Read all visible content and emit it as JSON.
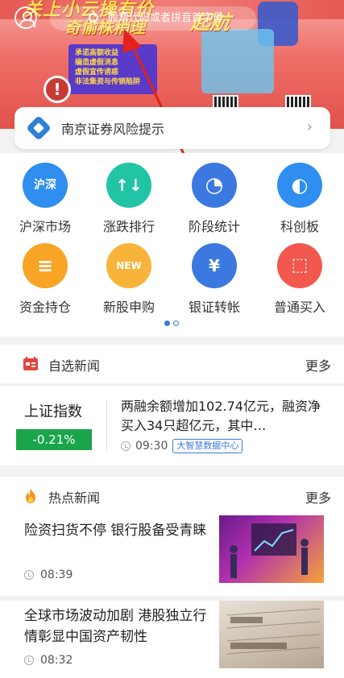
{
  "banner": {
    "headline": "关上小云操有价",
    "headline2": "奇偷株稍理",
    "cta": "起航",
    "board_items": [
      "承诺高额收益",
      "编造虚假消息",
      "虚假宣传诱惑",
      "非法集资与传销陷阱"
    ],
    "warning_glyph": "!",
    "search_placeholder": "股票代码或者拼音首字母"
  },
  "risk": {
    "label": "南京证券风险提示",
    "chevron": "›"
  },
  "quick": [
    {
      "label": "沪深市场",
      "glyph": "沪深",
      "color": "blue"
    },
    {
      "label": "涨跌排行",
      "glyph": "↑↓",
      "color": "teal"
    },
    {
      "label": "阶段统计",
      "glyph": "◔",
      "color": "blue2"
    },
    {
      "label": "科创板",
      "glyph": "◐",
      "color": "blue"
    },
    {
      "label": "资金持仓",
      "glyph": "≡",
      "color": "orange"
    },
    {
      "label": "新股申购",
      "glyph": "NEW",
      "color": "gold"
    },
    {
      "label": "银证转帐",
      "glyph": "¥",
      "color": "blue2"
    },
    {
      "label": "普通买入",
      "glyph": "⬚",
      "color": "red"
    }
  ],
  "watch_news": {
    "title": "自选新闻",
    "more": "更多",
    "index_name": "上证指数",
    "index_change": "-0.21%",
    "headline": "两融余额增加102.74亿元，融资净买入34只超亿元，其中…",
    "time": "09:30",
    "source": "大智慧数据中心"
  },
  "hot_news": {
    "title": "热点新闻",
    "more": "更多",
    "items": [
      {
        "title": "险资扫货不停 银行股备受青睐",
        "time": "08:39"
      },
      {
        "title": "全球市场波动加剧 港股独立行情彰显中国资产韧性",
        "time": "08:32"
      }
    ]
  }
}
